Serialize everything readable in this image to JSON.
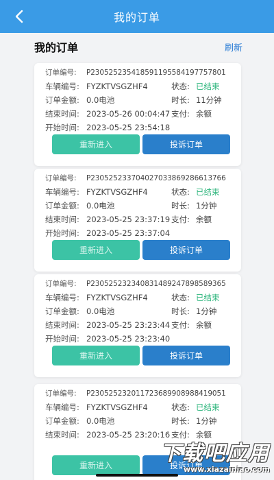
{
  "header": {
    "title": "我的订单"
  },
  "section": {
    "title": "我的订单",
    "refresh_label": "刷新"
  },
  "labels": {
    "order_no": "订单编号:",
    "vehicle_no": "车辆编号:",
    "amount": "订单金额:",
    "end_time": "结束时间:",
    "start_time": "开始时间:",
    "status": "状态:",
    "duration": "时长:",
    "payment": "支付:"
  },
  "buttons": {
    "reenter": "重新进入",
    "complain": "投诉订单"
  },
  "orders": [
    {
      "order_no": "P230525235418591195584197757801",
      "vehicle_no": "FYZKTVSGZHF4",
      "amount": "0.0电池",
      "end_time": "2023-05-26 00:04:47",
      "start_time": "2023-05-25 23:54:18",
      "status": "已结束",
      "duration": "11分钟",
      "payment": "余额"
    },
    {
      "order_no": "P230525233704027033869286613766",
      "vehicle_no": "FYZKTVSGZHF4",
      "amount": "0.0电池",
      "end_time": "2023-05-25 23:37:19",
      "start_time": "2023-05-25 23:37:04",
      "status": "已结束",
      "duration": "1分钟",
      "payment": "余额"
    },
    {
      "order_no": "P230525232340831489247898589365",
      "vehicle_no": "FYZKTVSGZHF4",
      "amount": "0.0电池",
      "end_time": "2023-05-25 23:23:44",
      "start_time": "2023-05-25 23:23:40",
      "status": "已结束",
      "duration": "1分钟",
      "payment": "余额"
    },
    {
      "order_no": "P230525232011723689908988419051",
      "vehicle_no": "FYZKTVSGZHF4",
      "amount": "0.0电池",
      "end_time": "2023-05-25 23:20:16",
      "start_time": "",
      "status": "已结束",
      "duration": "1分钟",
      "payment": "余额"
    }
  ],
  "watermark": {
    "main": "下载吧应用",
    "sub": "www.xiazainiao.com"
  },
  "icons": {
    "back": "chevron-left-icon"
  },
  "colors": {
    "header": "#3a9be6",
    "status_done": "#2db57c",
    "reenter": "#3cc3a5",
    "complain": "#2a7fcb",
    "link": "#2f7fd6"
  }
}
